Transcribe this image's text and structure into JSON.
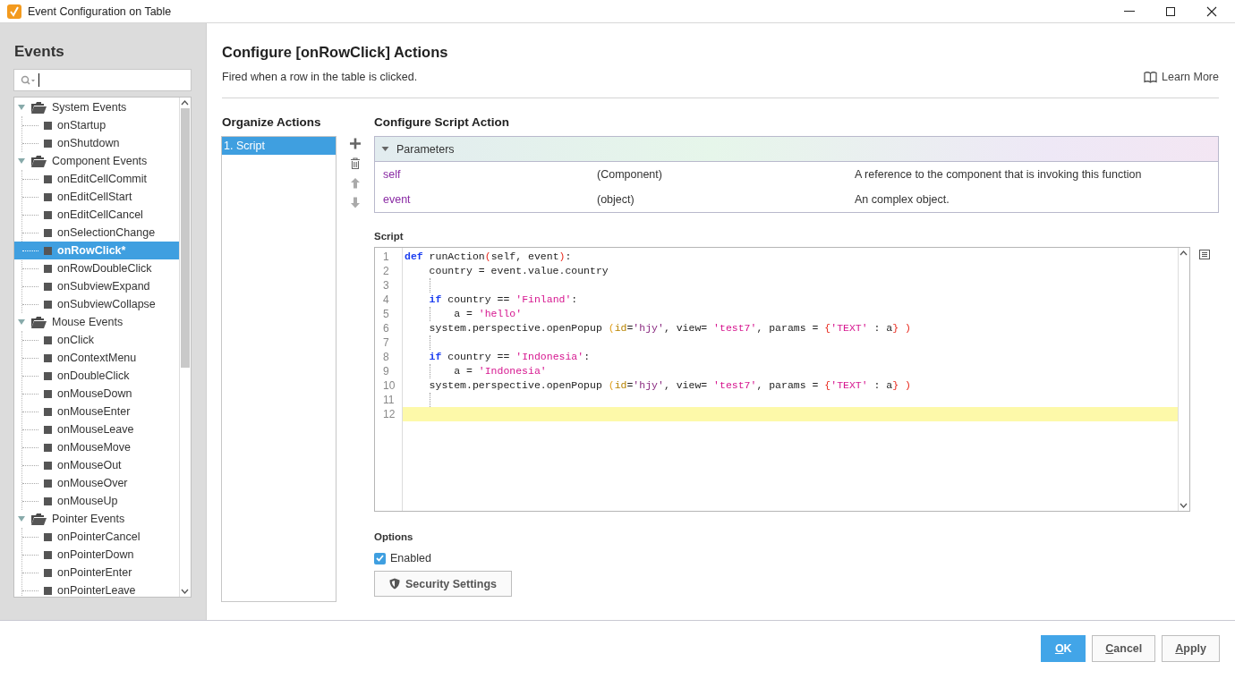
{
  "window": {
    "title": "Event Configuration on Table"
  },
  "sidebar": {
    "title": "Events",
    "tree": [
      {
        "label": "System Events",
        "expanded": true,
        "selected": false,
        "children": [
          {
            "label": "onStartup",
            "selected": false
          },
          {
            "label": "onShutdown",
            "selected": false
          }
        ]
      },
      {
        "label": "Component Events",
        "expanded": true,
        "selected": false,
        "children": [
          {
            "label": "onEditCellCommit",
            "selected": false
          },
          {
            "label": "onEditCellStart",
            "selected": false
          },
          {
            "label": "onEditCellCancel",
            "selected": false
          },
          {
            "label": "onSelectionChange",
            "selected": false
          },
          {
            "label": "onRowClick*",
            "selected": true
          },
          {
            "label": "onRowDoubleClick",
            "selected": false
          },
          {
            "label": "onSubviewExpand",
            "selected": false
          },
          {
            "label": "onSubviewCollapse",
            "selected": false
          }
        ]
      },
      {
        "label": "Mouse Events",
        "expanded": true,
        "selected": false,
        "children": [
          {
            "label": "onClick",
            "selected": false
          },
          {
            "label": "onContextMenu",
            "selected": false
          },
          {
            "label": "onDoubleClick",
            "selected": false
          },
          {
            "label": "onMouseDown",
            "selected": false
          },
          {
            "label": "onMouseEnter",
            "selected": false
          },
          {
            "label": "onMouseLeave",
            "selected": false
          },
          {
            "label": "onMouseMove",
            "selected": false
          },
          {
            "label": "onMouseOut",
            "selected": false
          },
          {
            "label": "onMouseOver",
            "selected": false
          },
          {
            "label": "onMouseUp",
            "selected": false
          }
        ]
      },
      {
        "label": "Pointer Events",
        "expanded": true,
        "selected": false,
        "children": [
          {
            "label": "onPointerCancel",
            "selected": false
          },
          {
            "label": "onPointerDown",
            "selected": false
          },
          {
            "label": "onPointerEnter",
            "selected": false
          },
          {
            "label": "onPointerLeave",
            "selected": false
          }
        ]
      }
    ]
  },
  "page": {
    "heading": "Configure [onRowClick] Actions",
    "description": "Fired when a row in the table is clicked.",
    "learn_more": "Learn More"
  },
  "organize": {
    "title": "Organize Actions",
    "actions": [
      {
        "label": "1. Script",
        "selected": true
      }
    ]
  },
  "configure": {
    "title": "Configure Script Action",
    "parameters": {
      "title": "Parameters",
      "expanded": true,
      "rows": [
        {
          "name": "self",
          "type": "(Component)",
          "description": "A reference to the component that is invoking this function"
        },
        {
          "name": "event",
          "type": "(object)",
          "description": "An complex object."
        }
      ]
    },
    "script_label": "Script",
    "lines": [
      {
        "number": "1",
        "current": false,
        "indent_guide": false,
        "kind": "top",
        "tokens": [
          {
            "kind": "kw",
            "text": "def"
          },
          {
            "kind": "plain",
            "text": " runAction"
          },
          {
            "kind": "paren",
            "text": "("
          },
          {
            "kind": "plain",
            "text": "self, event"
          },
          {
            "kind": "paren",
            "text": ")"
          },
          {
            "kind": "plain",
            "text": ":"
          }
        ]
      },
      {
        "number": "2",
        "current": false,
        "indent_guide": false,
        "kind": "body",
        "tokens": [
          {
            "kind": "plain",
            "text": "country = event.value.country"
          }
        ]
      },
      {
        "number": "3",
        "current": false,
        "indent_guide": true,
        "kind": "top"
      },
      {
        "number": "4",
        "current": false,
        "indent_guide": false,
        "kind": "body",
        "tokens": [
          {
            "kind": "kw",
            "text": "if"
          },
          {
            "kind": "plain",
            "text": " country == "
          },
          {
            "kind": "str",
            "text": "'Finland'"
          },
          {
            "kind": "plain",
            "text": ":"
          }
        ]
      },
      {
        "number": "5",
        "current": false,
        "indent_guide": true,
        "kind": "nested",
        "tokens": [
          {
            "kind": "plain",
            "text": "a = "
          },
          {
            "kind": "str",
            "text": "'hello'"
          }
        ]
      },
      {
        "number": "6",
        "current": false,
        "indent_guide": false,
        "kind": "body",
        "tokens": [
          {
            "kind": "plain",
            "text": "system.perspective.openPopup "
          },
          {
            "kind": "paren2",
            "text": "("
          },
          {
            "kind": "attr",
            "text": "id"
          },
          {
            "kind": "plain",
            "text": "="
          },
          {
            "kind": "str2",
            "text": "'hjy'"
          },
          {
            "kind": "plain",
            "text": ", view= "
          },
          {
            "kind": "str",
            "text": "'test7'"
          },
          {
            "kind": "plain",
            "text": ", params = "
          },
          {
            "kind": "paren",
            "text": "{"
          },
          {
            "kind": "str",
            "text": "'TEXT'"
          },
          {
            "kind": "plain",
            "text": " : a"
          },
          {
            "kind": "paren",
            "text": "} )"
          }
        ]
      },
      {
        "number": "7",
        "current": false,
        "indent_guide": true,
        "kind": "top"
      },
      {
        "number": "8",
        "current": false,
        "indent_guide": false,
        "kind": "body",
        "tokens": [
          {
            "kind": "kw",
            "text": "if"
          },
          {
            "kind": "plain",
            "text": " country == "
          },
          {
            "kind": "str",
            "text": "'Indonesia'"
          },
          {
            "kind": "plain",
            "text": ":"
          }
        ]
      },
      {
        "number": "9",
        "current": false,
        "indent_guide": true,
        "kind": "nested",
        "tokens": [
          {
            "kind": "plain",
            "text": "a = "
          },
          {
            "kind": "str",
            "text": "'Indonesia'"
          }
        ]
      },
      {
        "number": "10",
        "current": false,
        "indent_guide": false,
        "kind": "body",
        "tokens": [
          {
            "kind": "plain",
            "text": "system.perspective.openPopup "
          },
          {
            "kind": "paren2",
            "text": "("
          },
          {
            "kind": "attr",
            "text": "id"
          },
          {
            "kind": "plain",
            "text": "="
          },
          {
            "kind": "str2",
            "text": "'hjy'"
          },
          {
            "kind": "plain",
            "text": ", view= "
          },
          {
            "kind": "str",
            "text": "'test7'"
          },
          {
            "kind": "plain",
            "text": ", params = "
          },
          {
            "kind": "paren",
            "text": "{"
          },
          {
            "kind": "str",
            "text": "'TEXT'"
          },
          {
            "kind": "plain",
            "text": " : a"
          },
          {
            "kind": "paren",
            "text": "} )"
          }
        ]
      },
      {
        "number": "11",
        "current": false,
        "indent_guide": true,
        "kind": "top"
      },
      {
        "number": "12",
        "current": true,
        "indent_guide": false,
        "kind": "top"
      }
    ]
  },
  "options": {
    "title": "Options",
    "enabled": {
      "label": "Enabled",
      "checked": true
    },
    "security_button": "Security Settings"
  },
  "footer": {
    "buttons": [
      {
        "label": "OK",
        "kind": "primary",
        "mnemonic_underlined": true
      },
      {
        "label": "Cancel",
        "kind": "default",
        "mnemonic_underlined": true
      },
      {
        "label": "Apply",
        "kind": "default",
        "mnemonic_underlined": true
      }
    ]
  }
}
